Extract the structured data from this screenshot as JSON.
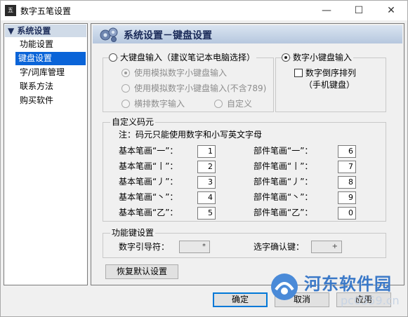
{
  "window": {
    "title": "数字五笔设置",
    "app_icon_text": "五",
    "min_glyph": "—",
    "max_glyph": "☐",
    "close_glyph": "✕"
  },
  "sidebar": {
    "header": "▼ 系统设置",
    "items": [
      {
        "label": "功能设置"
      },
      {
        "label": "键盘设置"
      },
      {
        "label": "字/词库管理"
      },
      {
        "label": "联系方法"
      },
      {
        "label": "购买软件"
      }
    ]
  },
  "panel": {
    "title": "系统设置－键盘设置"
  },
  "big_keyboard": {
    "label": "大键盘输入（建议笔记本电脑选择）",
    "options": [
      "使用模拟数字小键盘输入",
      "使用模拟数字小键盘输入(不含789)",
      "横排数字输入",
      "自定义"
    ]
  },
  "numpad": {
    "label": "数字小键盘输入",
    "reverse_label": "数字倒序排列",
    "reverse_sub": "（手机键盘）"
  },
  "custom_codes": {
    "legend": "自定义码元",
    "note": "注：码元只能使用数字和小写英文字母",
    "left_rows": [
      {
        "label": "基本笔画“一”：",
        "value": "1"
      },
      {
        "label": "基本笔画“丨”：",
        "value": "2"
      },
      {
        "label": "基本笔画“丿”：",
        "value": "3"
      },
      {
        "label": "基本笔画“丶”：",
        "value": "4"
      },
      {
        "label": "基本笔画“乙”：",
        "value": "5"
      }
    ],
    "right_rows": [
      {
        "label": "部件笔画“一”：",
        "value": "6"
      },
      {
        "label": "部件笔画“丨”：",
        "value": "7"
      },
      {
        "label": "部件笔画“丿”：",
        "value": "8"
      },
      {
        "label": "部件笔画“丶”：",
        "value": "9"
      },
      {
        "label": "部件笔画“乙”：",
        "value": "0"
      }
    ]
  },
  "function_keys": {
    "legend": "功能键设置",
    "lead_label": "数字引导符：",
    "lead_value": "*",
    "confirm_label": "选字确认键：",
    "confirm_value": "+"
  },
  "buttons": {
    "restore": "恢复默认设置",
    "ok": "确定",
    "cancel": "取消",
    "apply": "应用"
  },
  "watermark": {
    "text": "河东软件园",
    "url": "pc0359.cn"
  }
}
